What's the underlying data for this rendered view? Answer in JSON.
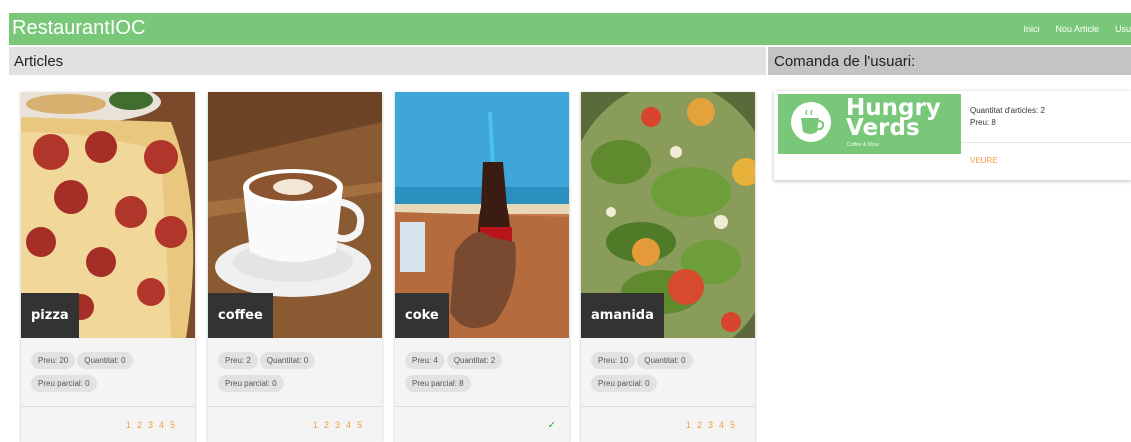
{
  "app": {
    "brand": "RestaurantIOC"
  },
  "nav": {
    "items": [
      "Inici",
      "Nou Article",
      "Usu"
    ]
  },
  "left": {
    "title": "Articles"
  },
  "right": {
    "title": "Comanda de l'usuari:"
  },
  "cards": [
    {
      "name": "pizza",
      "price": "Preu: 20",
      "qty": "Quantitat: 0",
      "partial": "Preu parcial: 0",
      "pages": [
        "1",
        "2",
        "3",
        "4",
        "5"
      ]
    },
    {
      "name": "coffee",
      "price": "Preu: 2",
      "qty": "Quantitat: 0",
      "partial": "Preu parcial: 0",
      "pages": [
        "1",
        "2",
        "3",
        "4",
        "5"
      ]
    },
    {
      "name": "coke",
      "price": "Preu: 4",
      "qty": "Quantitat: 2",
      "partial": "Preu parcial: 8",
      "check": "✓"
    },
    {
      "name": "amanida",
      "price": "Preu: 10",
      "qty": "Quantitat: 0",
      "partial": "Preu parcial: 0",
      "pages": [
        "1",
        "2",
        "3",
        "4",
        "5"
      ]
    }
  ],
  "order": {
    "logo_line1": "Hungry",
    "logo_line2": "Verds",
    "logo_sub": "Coffee & More",
    "items_count": "Quantitat d'articles: 2",
    "price": "Preu: 8",
    "link": "VEURE"
  },
  "colors": {
    "accent": "#79c879",
    "link": "#f0a040",
    "check": "#3aaa3a"
  }
}
